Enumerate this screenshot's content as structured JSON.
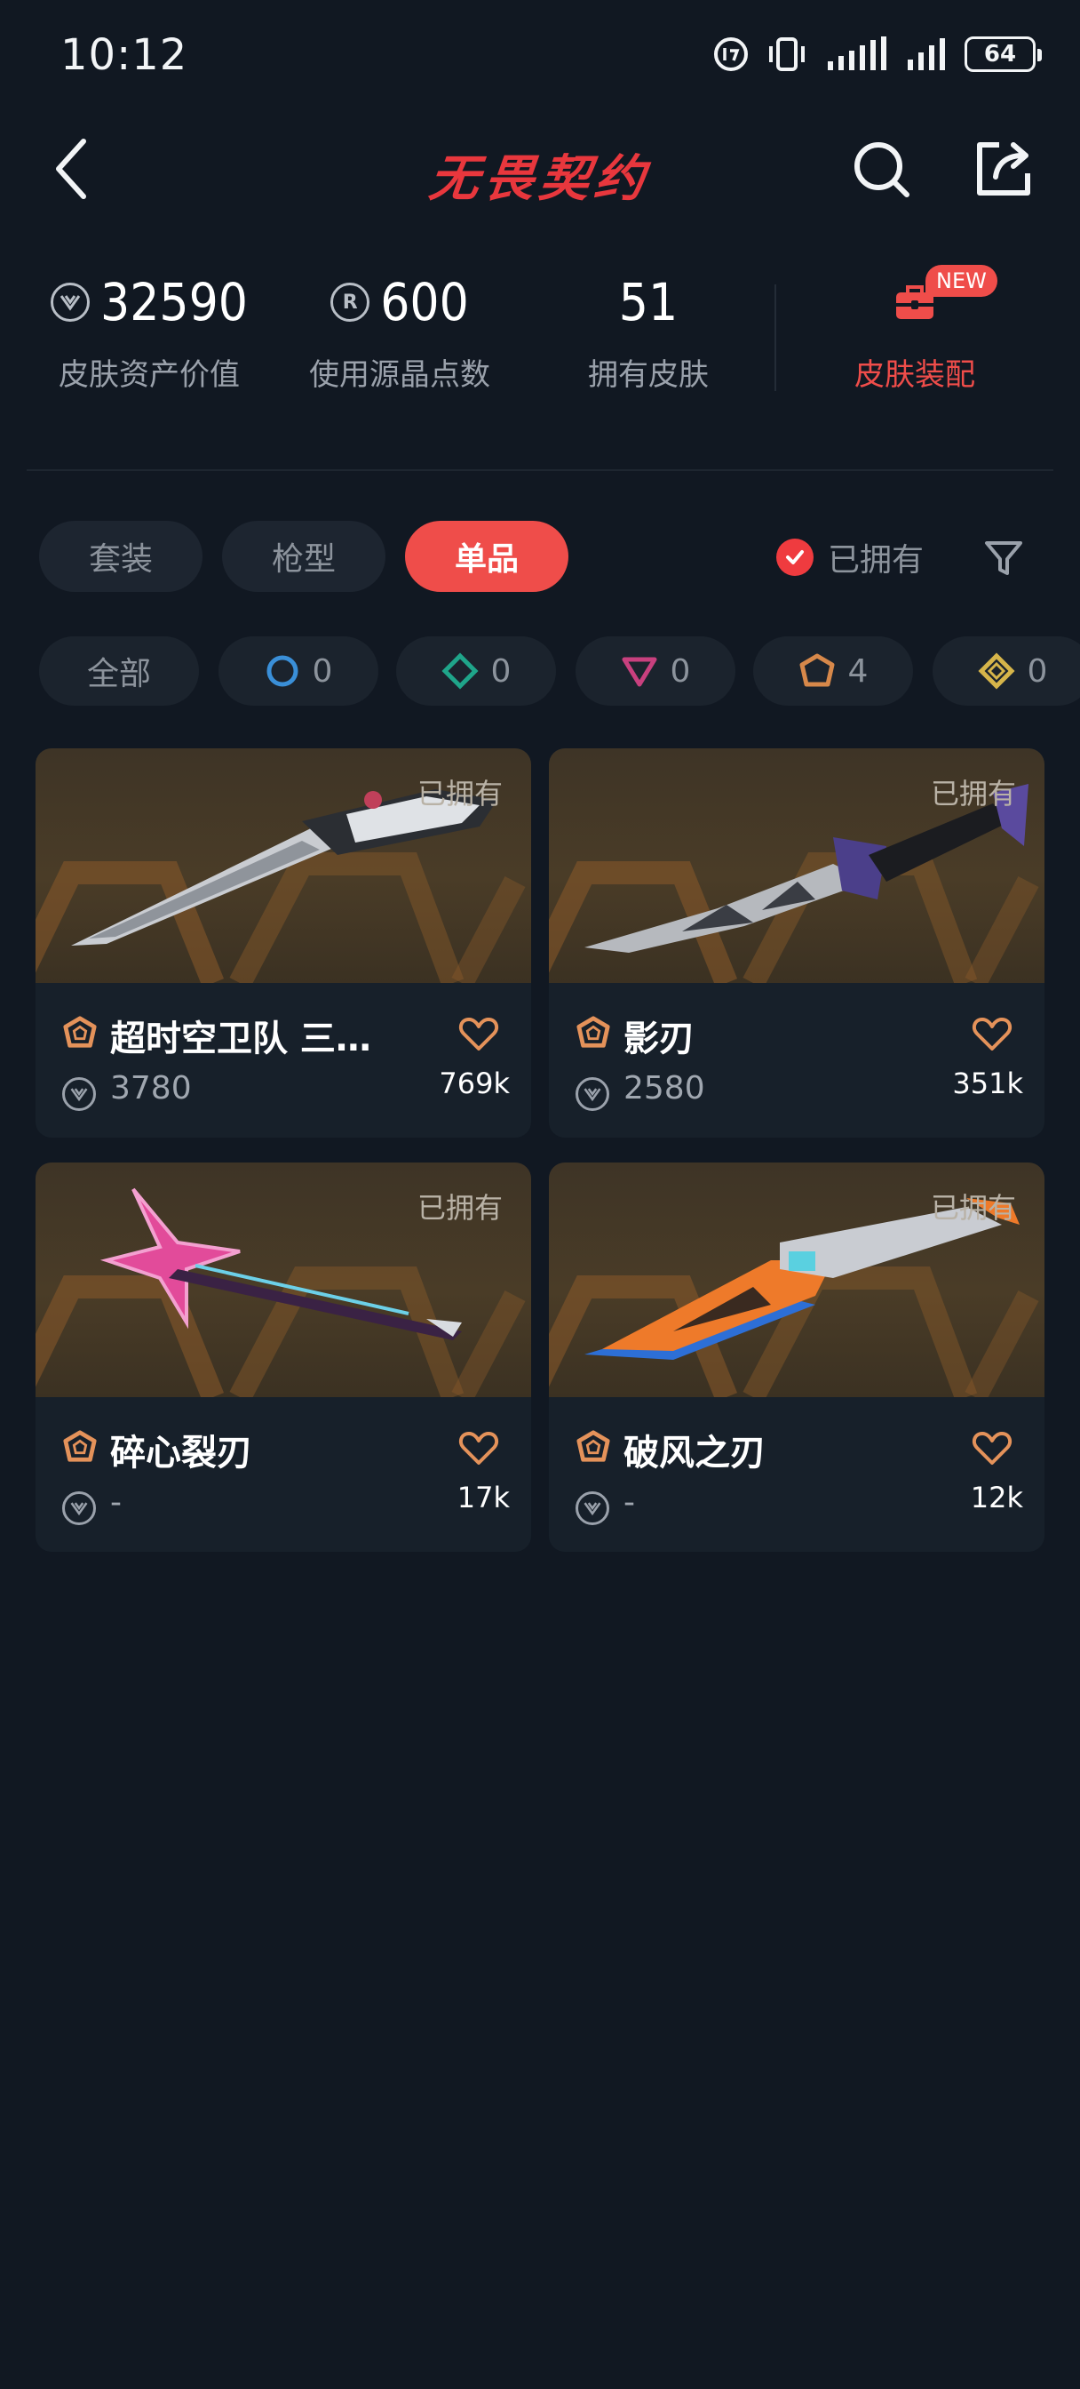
{
  "status_bar": {
    "time": "10:12",
    "battery": "64"
  },
  "header": {
    "title": "无畏契约"
  },
  "stats": {
    "asset_value": {
      "value": "32590",
      "label": "皮肤资产价值"
    },
    "radianite": {
      "value": "600",
      "icon_letter": "R",
      "label": "使用源晶点数"
    },
    "owned": {
      "value": "51",
      "label": "拥有皮肤"
    },
    "wardrobe": {
      "label": "皮肤装配",
      "badge": "NEW"
    }
  },
  "tabs": [
    {
      "label": "套装",
      "active": false
    },
    {
      "label": "枪型",
      "active": false
    },
    {
      "label": "单品",
      "active": true
    }
  ],
  "owned_filter": {
    "label": "已拥有",
    "checked": true
  },
  "rarity_chips": [
    {
      "label": "全部"
    },
    {
      "tier": "select",
      "color": "#3a8fd8",
      "count": "0"
    },
    {
      "tier": "deluxe",
      "color": "#1fa58a",
      "count": "0"
    },
    {
      "tier": "premium",
      "color": "#c8407e",
      "count": "0"
    },
    {
      "tier": "exclusive",
      "color": "#d7884a",
      "count": "4"
    },
    {
      "tier": "ultra",
      "color": "#d6b54a",
      "count": "0"
    }
  ],
  "cards": [
    {
      "name": "超时空卫队 三…",
      "owned_tag": "已拥有",
      "price": "3780",
      "likes": "769k",
      "tier_color": "#e4925a"
    },
    {
      "name": "影刃",
      "owned_tag": "已拥有",
      "price": "2580",
      "likes": "351k",
      "tier_color": "#e4925a"
    },
    {
      "name": "碎心裂刃",
      "owned_tag": "已拥有",
      "price": "-",
      "likes": "17k",
      "tier_color": "#e4925a"
    },
    {
      "name": "破风之刃",
      "owned_tag": "已拥有",
      "price": "-",
      "likes": "12k",
      "tier_color": "#e4925a"
    }
  ],
  "colors": {
    "accent": "#ef4d4a",
    "background": "#111822",
    "card": "#17202a"
  }
}
